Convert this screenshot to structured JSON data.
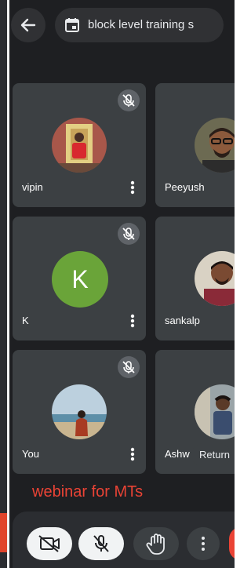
{
  "header": {
    "meeting_title": "block level training s",
    "back_icon": "arrow-left-icon",
    "calendar_icon": "calendar-icon"
  },
  "tiles": [
    {
      "name": "vipin",
      "avatar": "photo",
      "muted": true
    },
    {
      "name": "Peeyush",
      "avatar": "photo",
      "muted": false
    },
    {
      "name": "K",
      "avatar": "initial",
      "initial": "K",
      "avatar_color": "#6aa439",
      "muted": true
    },
    {
      "name": "sankalp",
      "avatar": "photo",
      "muted": false
    },
    {
      "name": "You",
      "avatar": "photo",
      "muted": true
    },
    {
      "name": "Ashw",
      "avatar": "photo",
      "muted": false
    }
  ],
  "return_chip": "Return",
  "caption": "webinar for MTs",
  "controls": {
    "camera": "camera-off-icon",
    "mic": "mic-off-icon",
    "hand": "raise-hand-icon",
    "more": "more-vert-icon"
  },
  "colors": {
    "background": "#1e1f22",
    "tile": "#3c4043",
    "caption": "#ea4335",
    "accent": "#6aa439"
  }
}
